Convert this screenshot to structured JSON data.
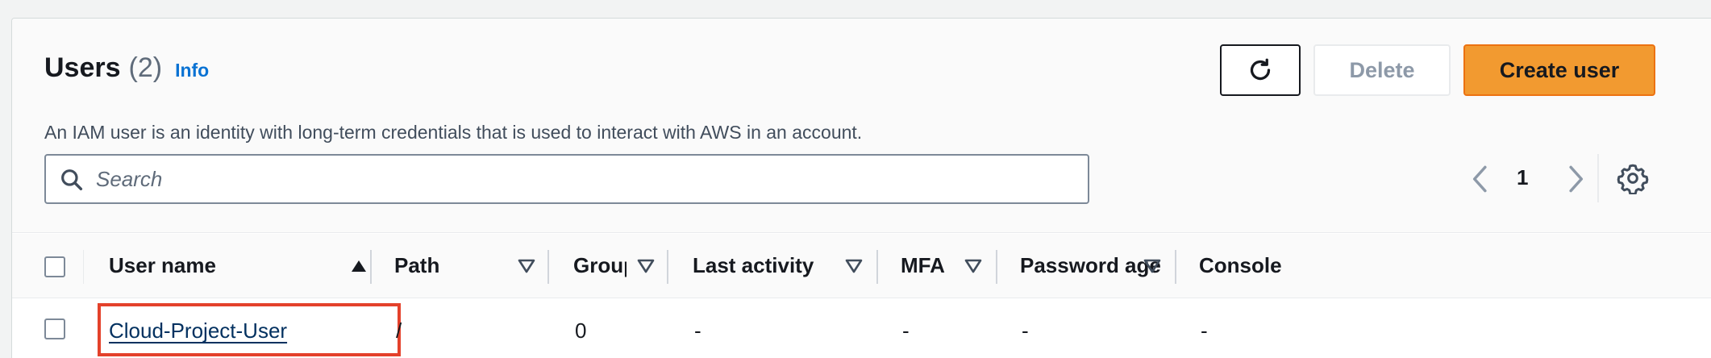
{
  "header": {
    "title": "Users",
    "count": "(2)",
    "info_link": "Info",
    "description": "An IAM user is an identity with long-term credentials that is used to interact with AWS in an account."
  },
  "toolbar": {
    "refresh_icon": "refresh-icon",
    "delete_label": "Delete",
    "create_label": "Create user"
  },
  "search": {
    "placeholder": "Search",
    "value": ""
  },
  "pagination": {
    "current_page": "1"
  },
  "table": {
    "columns": [
      "User name",
      "Path",
      "Groups",
      "Last activity",
      "MFA",
      "Password age",
      "Console"
    ],
    "sorted_column": "User name",
    "sort_direction": "ascending",
    "rows": [
      {
        "user_name": "Cloud-Project-User",
        "path": "/",
        "groups": "0",
        "last_activity": "-",
        "mfa": "-",
        "password_age": "-",
        "console": "-",
        "highlighted": true
      }
    ]
  },
  "colors": {
    "primary_button": "#f29a30",
    "link": "#0972d3",
    "highlight_box": "#e4412b"
  }
}
